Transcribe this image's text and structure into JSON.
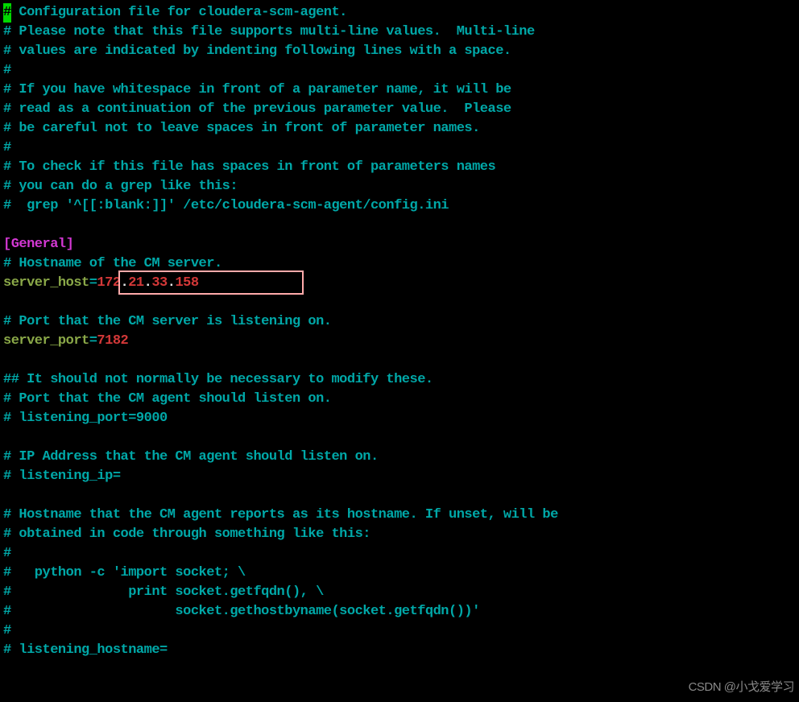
{
  "config": {
    "cursor_char": "#",
    "c1": " Configuration file for cloudera-scm-agent.",
    "c2": "# Please note that this file supports multi-line values.  Multi-line",
    "c3": "# values are indicated by indenting following lines with a space.",
    "c4": "#",
    "c5": "# If you have whitespace in front of a parameter name, it will be",
    "c6": "# read as a continuation of the previous parameter value.  Please",
    "c7": "# be careful not to leave spaces in front of parameter names.",
    "c8": "#",
    "c9": "# To check if this file has spaces in front of parameters names",
    "c10": "# you can do a grep like this:",
    "c11": "#  grep '^[[:blank:]]' /etc/cloudera-scm-agent/config.ini",
    "section": "[General]",
    "c12": "# Hostname of the CM server.",
    "server_host_key": "server_host",
    "server_host_ip1": "172",
    "server_host_ip2": "21",
    "server_host_ip3": "33",
    "server_host_ip4": "158",
    "dot": ".",
    "equals": "=",
    "c13": "# Port that the CM server is listening on.",
    "server_port_key": "server_port",
    "server_port_val": "7182",
    "c14": "## It should not normally be necessary to modify these.",
    "c15": "# Port that the CM agent should listen on.",
    "c16": "# listening_port=9000",
    "c17": "# IP Address that the CM agent should listen on.",
    "c18": "# listening_ip=",
    "c19": "# Hostname that the CM agent reports as its hostname. If unset, will be",
    "c20": "# obtained in code through something like this:",
    "c21": "#",
    "c22": "#   python -c 'import socket; \\",
    "c23": "#               print socket.getfqdn(), \\",
    "c24": "#                     socket.gethostbyname(socket.getfqdn())'",
    "c25": "#",
    "c26": "# listening_hostname="
  },
  "highlight": {
    "top": "336",
    "left": "147",
    "width": "230",
    "height": "30"
  },
  "watermark": "CSDN @小戈爱学习"
}
